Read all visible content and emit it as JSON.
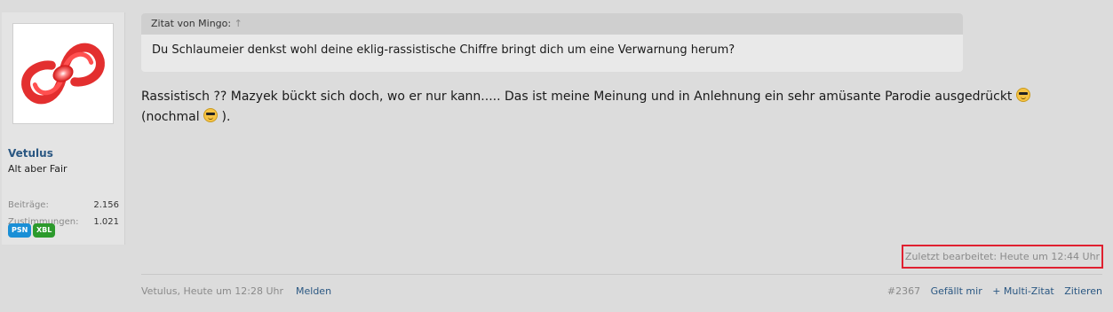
{
  "user": {
    "name": "Vetulus",
    "title": "Alt aber Fair",
    "stats": [
      {
        "label": "Beiträge:",
        "value": "2.156"
      },
      {
        "label": "Zustimmungen:",
        "value": "1.021"
      }
    ],
    "badges": [
      {
        "label": "PSN",
        "color": "#1a8fd6"
      },
      {
        "label": "XBL",
        "color": "#2c9a2c"
      }
    ]
  },
  "quote": {
    "header": "Zitat von Mingo:",
    "arrow": "↑",
    "text": "Du Schlaumeier denkst wohl deine eklig-rassistische Chiffre bringt dich um eine Verwarnung herum?"
  },
  "message": {
    "part1": "Rassistisch ?? Mazyek bückt sich doch, wo er nur kann..... Das ist meine Meinung und in Anlehnung ein sehr amüsante Parodie ausgedrückt",
    "part2": "(nochmal",
    "part3": ")."
  },
  "edited": "Zuletzt bearbeitet: Heute um 12:44 Uhr",
  "footer": {
    "author_time": "Vetulus, Heute um 12:28 Uhr",
    "report": "Melden",
    "post_number": "#2367",
    "like": "Gefällt mir",
    "multiquote": "+ Multi-Zitat",
    "quote": "Zitieren"
  },
  "colors": {
    "accent": "#2a5782",
    "highlight": "#e02030"
  }
}
